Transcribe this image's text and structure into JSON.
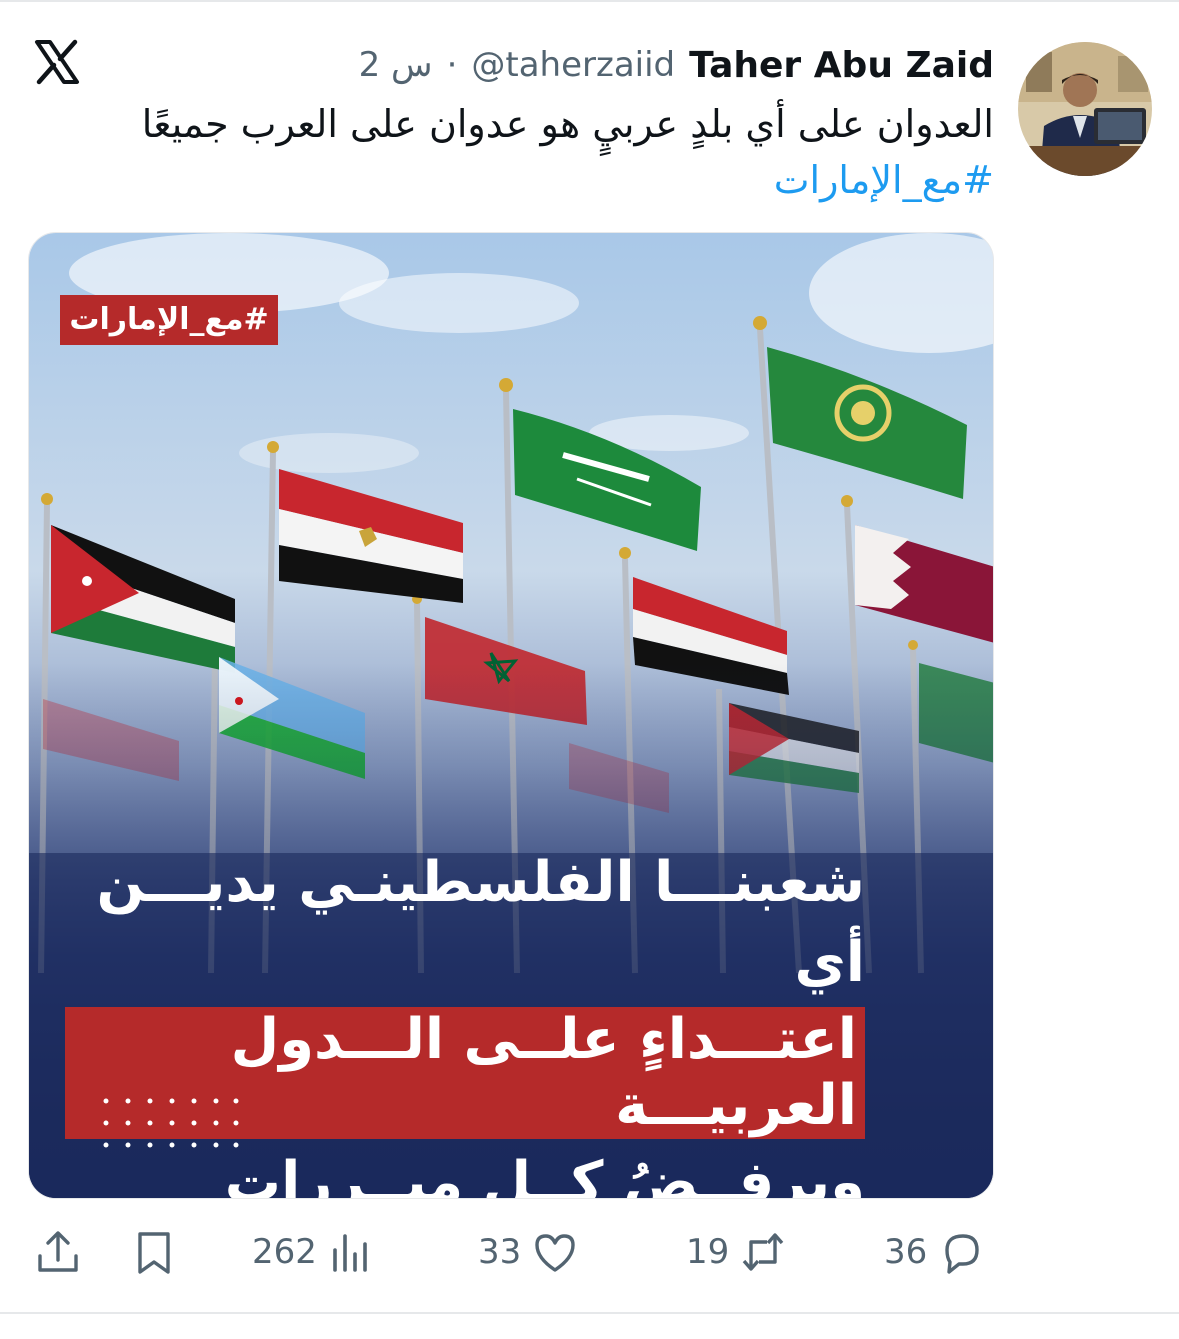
{
  "tweet": {
    "author_name": "Taher Abu Zaid",
    "author_handle": "@taherzaiid",
    "separator": "·",
    "time": "2 س",
    "text": "العدوان على أي بلدٍ عربيٍ هو عدوان على العرب جميعًا",
    "hashtag": "#مع_الإمارات"
  },
  "media": {
    "tag": "#مع_الإمارات",
    "headline_line1": "شعبنـــا الفلسطينـي يديـــن أي",
    "headline_line2": "اعتـــداءٍ علــى الـــدول العربيـــة",
    "headline_line3": "ويرفــضُ كــل مبــررات العـــدوان",
    "flags": [
      "jordan-flag",
      "egypt-flag",
      "saudi-flag",
      "arab-league-flag",
      "qatar-flag",
      "yemen-flag",
      "morocco-flag",
      "djibouti-flag",
      "palestine-flag",
      "algeria-flag"
    ]
  },
  "actions": {
    "reply_count": "36",
    "retweet_count": "19",
    "like_count": "33",
    "views_count": "262"
  },
  "colors": {
    "link": "#1d9bf0",
    "muted": "#536471",
    "tag_red": "#b52a2a",
    "navy": "#1b2a5c"
  }
}
